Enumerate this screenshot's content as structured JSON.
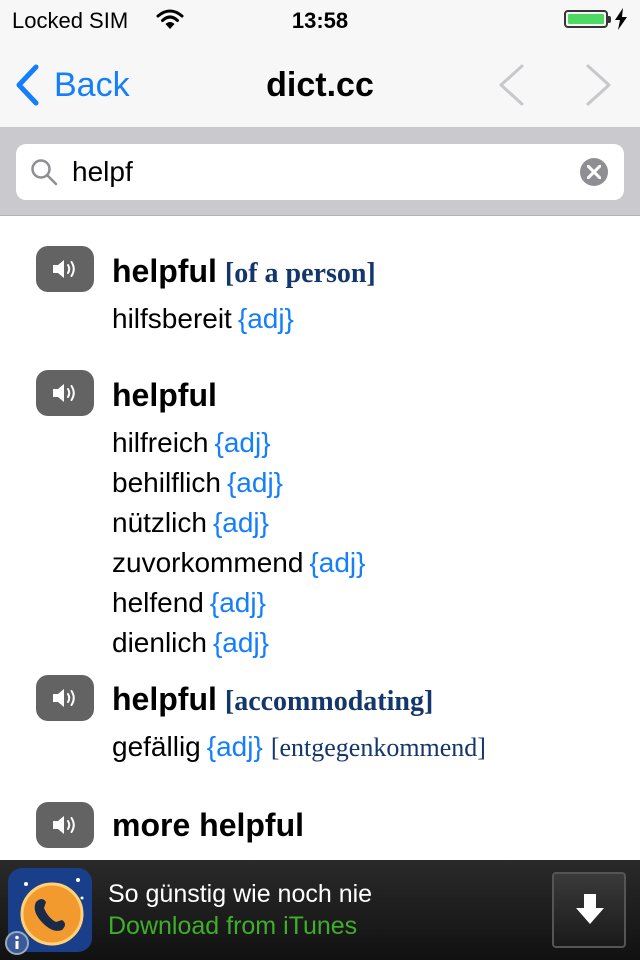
{
  "status": {
    "carrier": "Locked SIM",
    "time": "13:58",
    "battery_color": "#4cd964"
  },
  "nav": {
    "back_label": "Back",
    "title": "dict.cc",
    "accent": "#157efb"
  },
  "search": {
    "query": "helpf",
    "placeholder": ""
  },
  "results": [
    {
      "term": "helpful",
      "note": "[of a person]",
      "translations": [
        {
          "word": "hilfsbereit",
          "tag": "{adj}",
          "note": ""
        }
      ]
    },
    {
      "term": "helpful",
      "note": "",
      "translations": [
        {
          "word": "hilfreich",
          "tag": "{adj}",
          "note": ""
        },
        {
          "word": "behilflich",
          "tag": "{adj}",
          "note": ""
        },
        {
          "word": "nützlich",
          "tag": "{adj}",
          "note": ""
        },
        {
          "word": "zuvorkommend",
          "tag": "{adj}",
          "note": ""
        },
        {
          "word": "helfend",
          "tag": "{adj}",
          "note": ""
        },
        {
          "word": "dienlich",
          "tag": "{adj}",
          "note": ""
        }
      ]
    },
    {
      "term": "helpful",
      "note": "[accommodating]",
      "translations": [
        {
          "word": "gefällig",
          "tag": "{adj}",
          "note": "[entgegenkommend]"
        }
      ]
    },
    {
      "term": "more helpful",
      "note": "",
      "translations": []
    }
  ],
  "ad": {
    "headline": "So günstig wie noch nie",
    "cta": "Download from iTunes",
    "cta_color": "#3fae2a"
  }
}
